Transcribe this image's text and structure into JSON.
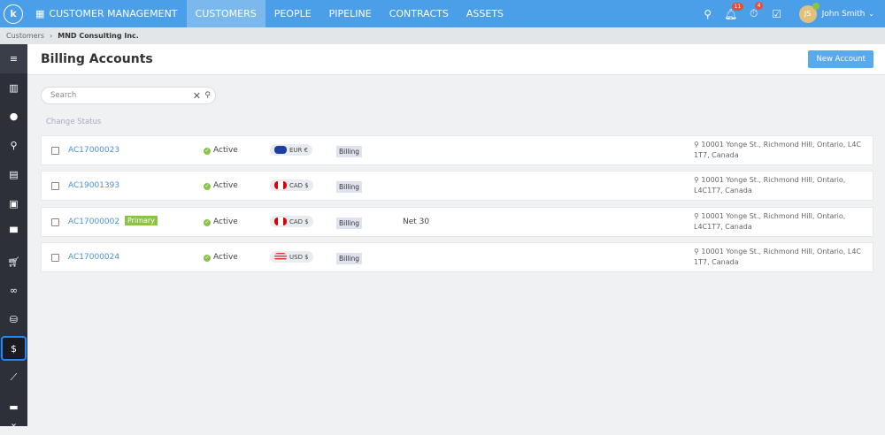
{
  "topbar": {
    "logo": "k",
    "app_title": "CUSTOMER MANAGEMENT",
    "nav": [
      "CUSTOMERS",
      "PEOPLE",
      "PIPELINE",
      "CONTRACTS",
      "ASSETS"
    ],
    "active_nav": "CUSTOMERS",
    "notifications_count": "11",
    "tasks_count": "4",
    "user_initials": "JS",
    "user_name": "John Smith"
  },
  "breadcrumb": {
    "root": "Customers",
    "current": "MND Consulting Inc."
  },
  "page": {
    "title": "Billing Accounts",
    "new_button": "New Account",
    "search_placeholder": "Search",
    "change_status": "Change Status"
  },
  "accounts": [
    {
      "id": "AC17000023",
      "primary": "",
      "status": "Active",
      "currency": "EUR €",
      "flag": "eu",
      "type": "Billing",
      "terms": "",
      "address": "10001 Yonge St., Richmond Hill, Ontario, L4C 1T7, Canada"
    },
    {
      "id": "AC19001393",
      "primary": "",
      "status": "Active",
      "currency": "CAD $",
      "flag": "ca",
      "type": "Billing",
      "terms": "",
      "address": "10001 Yonge St., Richmond Hill, Ontario, L4C1T7, Canada"
    },
    {
      "id": "AC17000002",
      "primary": "Primary",
      "status": "Active",
      "currency": "CAD $",
      "flag": "ca",
      "type": "Billing",
      "terms": "Net 30",
      "address": "10001 Yonge St., Richmond Hill, Ontario, L4C1T7, Canada"
    },
    {
      "id": "AC17000024",
      "primary": "",
      "status": "Active",
      "currency": "USD $",
      "flag": "us",
      "type": "Billing",
      "terms": "",
      "address": "10001 Yonge St., Richmond Hill, Ontario, L4C 1T7, Canada"
    }
  ],
  "colors": {
    "topbar": "#4b9fe8",
    "sidebar": "#2d3039",
    "link": "#4a90d9",
    "active": "#8bc34a",
    "selected_outline": "#1e88ff"
  }
}
